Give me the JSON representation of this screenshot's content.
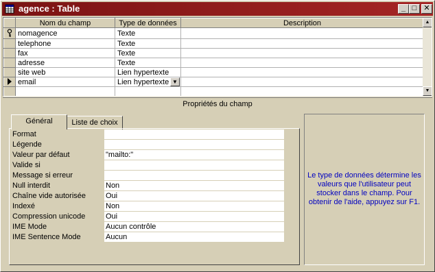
{
  "window": {
    "title": "agence : Table",
    "controls": {
      "minimize": "_",
      "maximize": "□",
      "close": "✕"
    }
  },
  "grid": {
    "columns": [
      "Nom du champ",
      "Type de données",
      "Description"
    ],
    "rows": [
      {
        "indicator": "key-icon",
        "name": "nomagence",
        "type": "Texte",
        "description": ""
      },
      {
        "indicator": "",
        "name": "telephone",
        "type": "Texte",
        "description": ""
      },
      {
        "indicator": "",
        "name": "fax",
        "type": "Texte",
        "description": ""
      },
      {
        "indicator": "",
        "name": "adresse",
        "type": "Texte",
        "description": ""
      },
      {
        "indicator": "",
        "name": "site web",
        "type": "Lien hypertexte",
        "description": ""
      },
      {
        "indicator": "current-row-arrow-icon",
        "name": "email",
        "type": "Lien hypertexte",
        "description": ""
      }
    ]
  },
  "properties": {
    "title": "Propriétés du champ",
    "tabs": [
      "Général",
      "Liste de choix"
    ],
    "active_tab": "Général",
    "fields": [
      {
        "label": "Format",
        "value": ""
      },
      {
        "label": "Légende",
        "value": ""
      },
      {
        "label": "Valeur par défaut",
        "value": "\"mailto:\""
      },
      {
        "label": "Valide si",
        "value": ""
      },
      {
        "label": "Message si erreur",
        "value": ""
      },
      {
        "label": "Null interdit",
        "value": "Non"
      },
      {
        "label": "Chaîne vide autorisée",
        "value": "Oui"
      },
      {
        "label": "Indexé",
        "value": "Non"
      },
      {
        "label": "Compression unicode",
        "value": "Oui"
      },
      {
        "label": "IME Mode",
        "value": "Aucun contrôle"
      },
      {
        "label": "IME Sentence Mode",
        "value": "Aucun"
      }
    ]
  },
  "help": {
    "text": "Le type de données détermine les valeurs que l'utilisateur peut stocker dans le champ. Pour obtenir de l'aide, appuyez sur F1."
  },
  "colors": {
    "titlebar": "#7a1313",
    "background": "#d6cfb6",
    "help_text": "#0000c0"
  }
}
